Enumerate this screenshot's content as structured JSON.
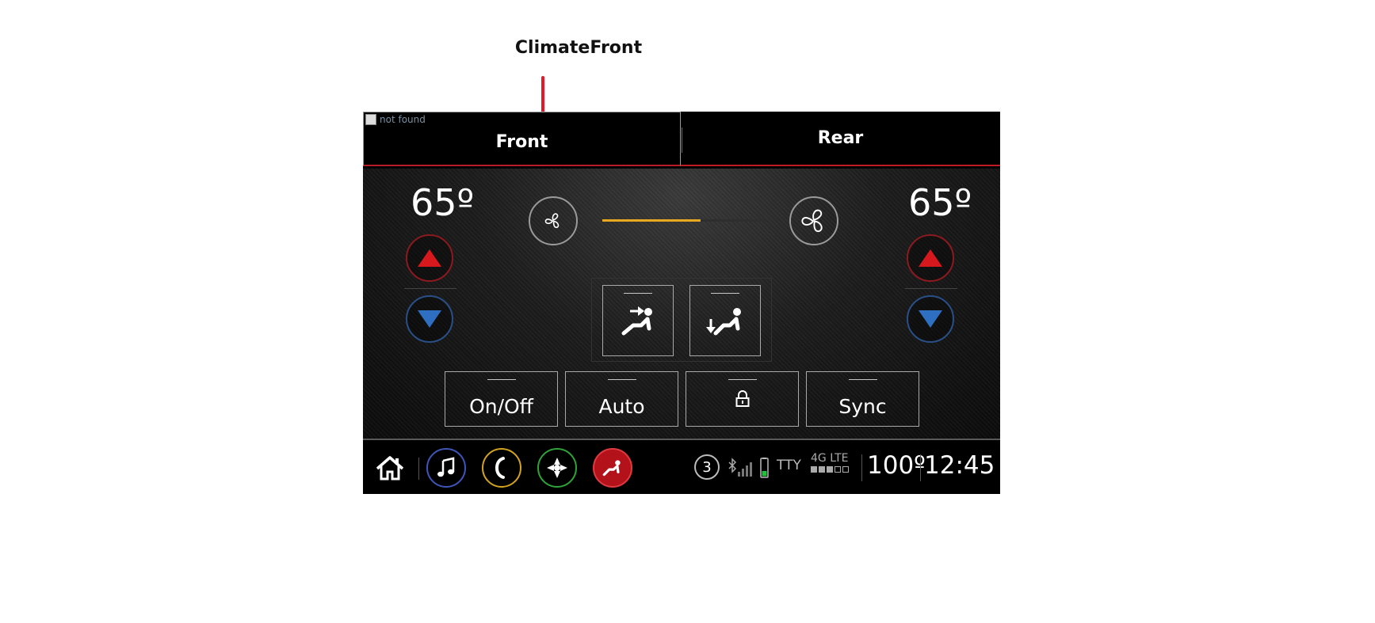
{
  "annotation": {
    "label": "ClimateFront",
    "accent": "#e21b2b"
  },
  "tabs": [
    {
      "label": "Front",
      "active": true
    },
    {
      "label": "Rear",
      "active": false
    }
  ],
  "broken_image": {
    "alt": "not found"
  },
  "climate": {
    "left_temp": "65º",
    "right_temp": "65º",
    "fan_level_percent": 60,
    "fan_color": "#e8a820",
    "up_color": "#d7191e",
    "down_color": "#2f6fc1"
  },
  "mode_buttons": [
    {
      "icon": "seat-face-vent-icon"
    },
    {
      "icon": "seat-floor-vent-icon"
    }
  ],
  "controls": [
    {
      "label": "On/Off"
    },
    {
      "label": "Auto"
    },
    {
      "label": "",
      "icon": "lock-icon"
    },
    {
      "label": "Sync"
    }
  ],
  "status": {
    "notification_count": "3",
    "tty": "TTY",
    "network": "4G LTE",
    "outside_temp": "100º",
    "time": "12:45"
  },
  "app_colors": {
    "media": "#3d56b8",
    "phone": "#d2a31e",
    "nav": "#2ea33a",
    "climate": "#c0141e"
  }
}
